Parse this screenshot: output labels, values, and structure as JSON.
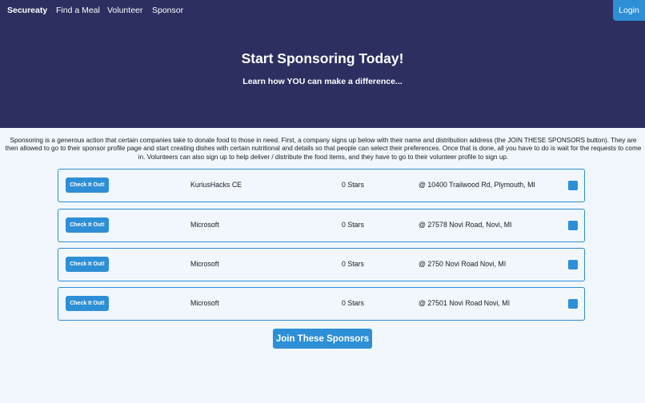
{
  "nav": {
    "brand": "Secureaty",
    "links": [
      "Find a Meal",
      "Volunteer",
      "Sponsor"
    ],
    "login": "Login"
  },
  "hero": {
    "title": "Start Sponsoring Today!",
    "subtitle": "Learn how YOU can make a difference..."
  },
  "intro": "Sponsoring is a generous action that certain companies take to donate food to those in need. First, a company signs up below with their name and distribution address (the JOIN THESE SPONSORS button). They are then allowed to go to their sponsor profile page and start creating dishes with certain nutritional and details so that people can select their preferences. Once that is done, all you have to do is wait for the requests to come in. Volunteers can also sign up to help deliver / distribute the food items, and they have to go to their volunteer profile to sign up.",
  "sponsors": [
    {
      "button": "Check It Out!",
      "name": "KuriusHacks CE",
      "stars": "0 Stars",
      "address": "@ 10400 Trailwood Rd, Plymouth, MI"
    },
    {
      "button": "Check It Out!",
      "name": "Microsoft",
      "stars": "0 Stars",
      "address": "@ 27578 Novi Road, Novi, MI"
    },
    {
      "button": "Check It Out!",
      "name": "Microsoft",
      "stars": "0 Stars",
      "address": "@ 2750 Novi Road Novi, MI"
    },
    {
      "button": "Check It Out!",
      "name": "Microsoft",
      "stars": "0 Stars",
      "address": "@ 27501 Novi Road Novi, MI"
    }
  ],
  "join_button": "Join These Sponsors",
  "colors": {
    "hero_background": "#2c2f5f",
    "accent": "#2d8fd6",
    "page_background": "#f1f7fd"
  }
}
